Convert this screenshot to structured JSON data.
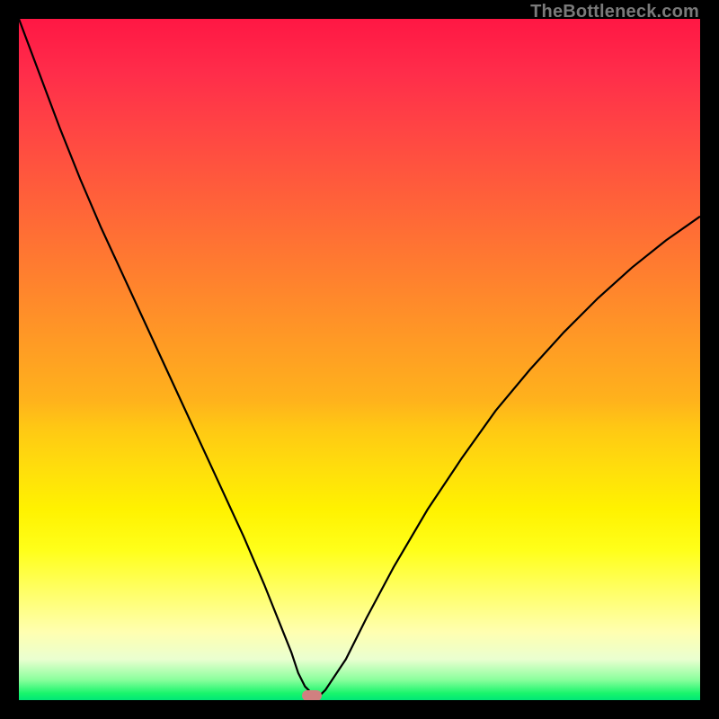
{
  "watermark": "TheBottleneck.com",
  "chart_data": {
    "type": "line",
    "title": "",
    "xlabel": "",
    "ylabel": "",
    "x": [
      0,
      3,
      6,
      9,
      12,
      15,
      18,
      21,
      24,
      27,
      30,
      33,
      36,
      38,
      40,
      41,
      42,
      43,
      44,
      45,
      48,
      51,
      55,
      60,
      65,
      70,
      75,
      80,
      85,
      90,
      95,
      100
    ],
    "values": [
      100,
      92,
      84,
      76.5,
      69.5,
      63,
      56.5,
      50,
      43.5,
      37,
      30.5,
      24,
      17,
      12,
      7,
      4,
      2,
      1,
      0.5,
      1.5,
      6,
      12,
      19.5,
      28,
      35.5,
      42.5,
      48.5,
      54,
      59,
      63.5,
      67.5,
      71
    ],
    "xlim": [
      0,
      100
    ],
    "ylim": [
      0,
      100
    ],
    "marker": {
      "x": 43,
      "y": 1
    },
    "background_gradient": [
      "#ff1744",
      "#ffde0c",
      "#00e676"
    ]
  }
}
